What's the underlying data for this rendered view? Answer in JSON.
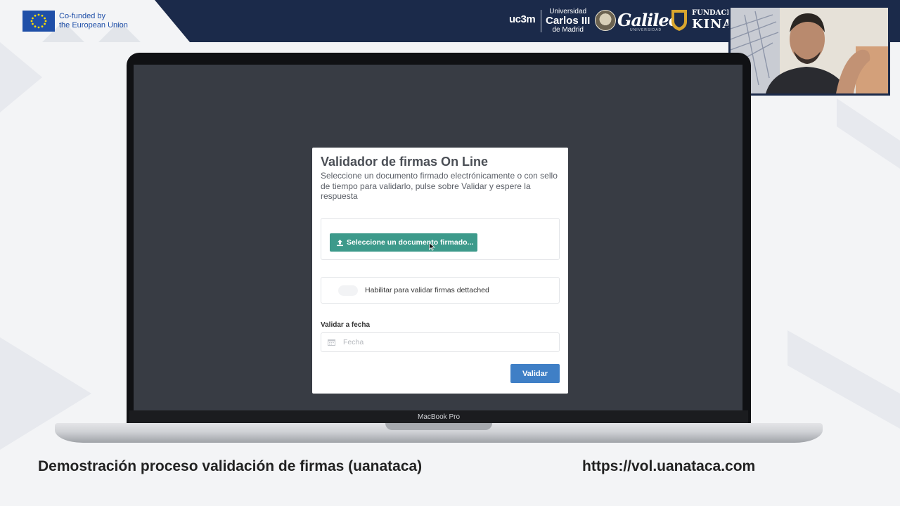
{
  "banner": {
    "eu_line1": "Co-funded by",
    "eu_line2": "the European Union",
    "uc3m": "uc3m",
    "uni_line1": "Universidad",
    "uni_line2": "Carlos III",
    "uni_line3": "de Madrid",
    "galileo": "Galileo",
    "galileo_sub": "UNIVERSIDAD",
    "kinal_line1": "FUNDACIÓ",
    "kinal_line2": "KINAL"
  },
  "laptop": {
    "brand": "MacBook Pro"
  },
  "validator": {
    "title": "Validador de firmas On Line",
    "description": "Seleccione un documento firmado electrónicamente o con sello de tiempo para validarlo, pulse sobre Validar y espere la respuesta",
    "upload_button": "Seleccione un documento firmado...",
    "dettached_label": "Habilitar para validar firmas dettached",
    "date_label": "Validar a fecha",
    "date_placeholder": "Fecha",
    "submit_button": "Validar",
    "colors": {
      "upload": "#3d9a8b",
      "submit": "#3f7fc6"
    }
  },
  "caption": {
    "left": "Demostración proceso validación de firmas (uanataca)",
    "right": "https://vol.uanataca.com"
  },
  "icons": [
    "upload-icon",
    "calendar-icon",
    "mouse-cursor-icon",
    "eu-flag-icon",
    "shield-icon"
  ]
}
